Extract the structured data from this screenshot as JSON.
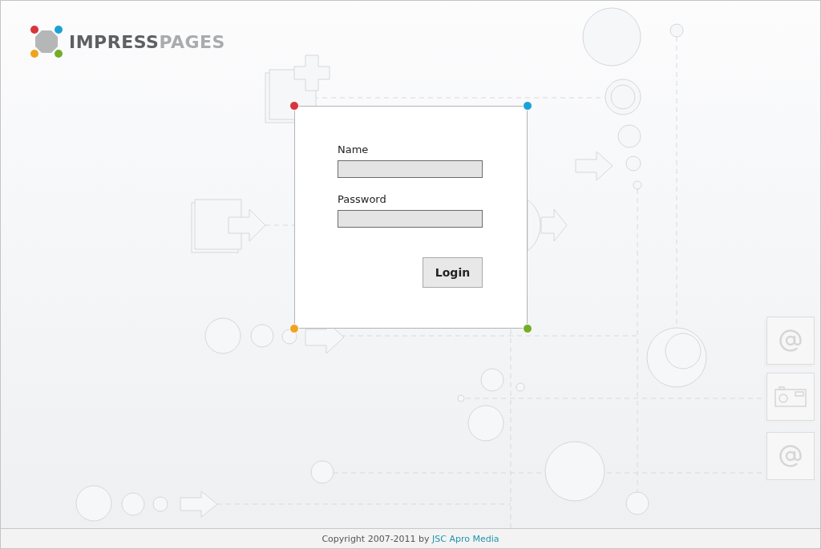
{
  "logo": {
    "primary": "IMPRESS",
    "secondary": "PAGES"
  },
  "login_form": {
    "fields": [
      {
        "label": "Name"
      },
      {
        "label": "Password"
      }
    ],
    "submit": "Login"
  },
  "footer": {
    "text": "Copyright 2007-2011 by",
    "link": "JSC Apro Media"
  }
}
